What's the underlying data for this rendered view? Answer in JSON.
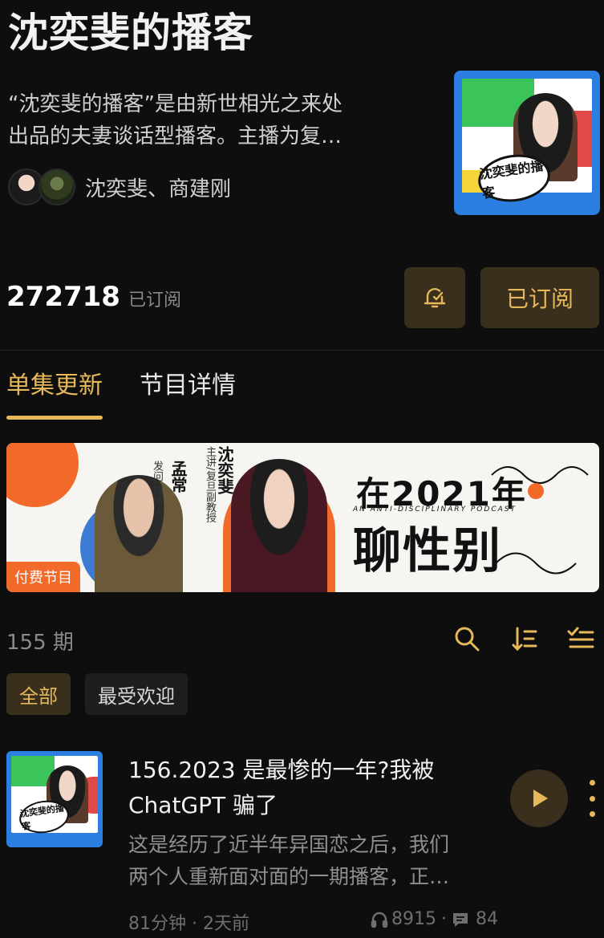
{
  "podcast": {
    "title": "沈奕斐的播客",
    "description_line1": "“沈奕斐的播客”是由新世相光之来处",
    "description_line2": "出品的夫妻谈话型播客。主播为复…",
    "hosts": "沈奕斐、商建刚",
    "subscriber_count": "272718",
    "subscriber_label": "已订阅",
    "subscribe_button": "已订阅",
    "cover_text": "沈奕斐的播客"
  },
  "tabs": [
    {
      "label": "单集更新",
      "active": true
    },
    {
      "label": "节目详情",
      "active": false
    }
  ],
  "banner": {
    "host1_name": "孟常",
    "host1_role": "发问/媒体人",
    "host2_name": "沈奕斐",
    "host2_role": "主讲/复旦副教授",
    "title_line1": "在2021年",
    "subtitle": "AN ANTI-DISCIPLINARY PODCAST",
    "title_line2": "聊性别",
    "paid_tag": "付费节目"
  },
  "episodes_count": "155 期",
  "filters": [
    {
      "label": "全部",
      "active": true
    },
    {
      "label": "最受欢迎",
      "active": false
    }
  ],
  "episode": {
    "title_line1": "156.2023 是最惨的一年?我被",
    "title_line2": "ChatGPT 骗了",
    "desc_line1": "这是经历了近半年异国恋之后，我们",
    "desc_line2": "两个人重新面对面的一期播客，正…",
    "meta": "81分钟 · 2天前",
    "plays": "8915",
    "separator": "·",
    "comments": "84",
    "cover_text": "沈奕斐的播客"
  },
  "colors": {
    "accent": "#e7b85a",
    "button_bg": "#3a2f1d",
    "background": "#0e0e0f"
  },
  "icons": [
    "bell-icon",
    "search-icon",
    "sort-icon",
    "checklist-icon",
    "play-icon",
    "more-icon",
    "headphones-icon",
    "comment-icon"
  ]
}
